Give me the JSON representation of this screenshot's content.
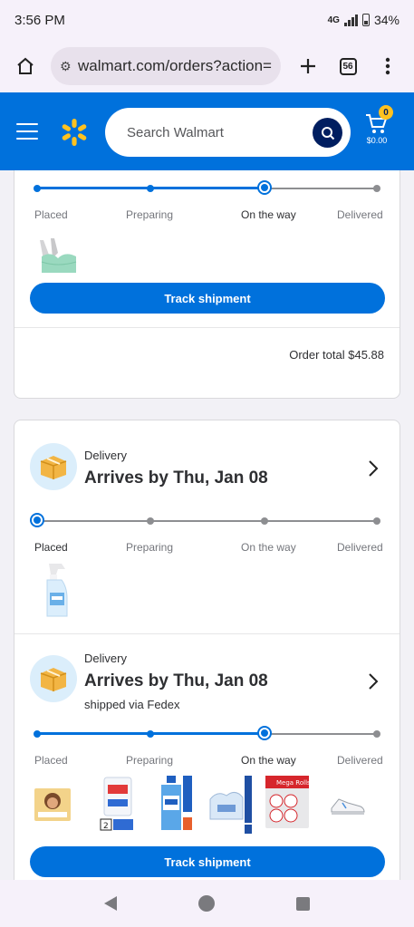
{
  "status_bar": {
    "time": "3:56 PM",
    "network": "4G",
    "battery": "34%"
  },
  "browser": {
    "url": "walmart.com/orders?action=",
    "tab_count": "56"
  },
  "header": {
    "search_placeholder": "Search Walmart",
    "cart_count": "0",
    "cart_total": "$0.00"
  },
  "steps": [
    "Placed",
    "Preparing",
    "On the way",
    "Delivered"
  ],
  "order1": {
    "progress_step": 2,
    "track_button": "Track shipment",
    "order_total": "Order total $45.88"
  },
  "order2": {
    "shipment1": {
      "type": "Delivery",
      "arrival": "Arrives by Thu, Jan 08",
      "progress_step": 0
    },
    "shipment2": {
      "type": "Delivery",
      "arrival": "Arrives by Thu, Jan 08",
      "carrier": "shipped via Fedex",
      "progress_step": 2,
      "track_button": "Track shipment"
    }
  },
  "colors": {
    "brand_blue": "#0071dc",
    "spark_yellow": "#ffc220",
    "navy": "#001e60"
  }
}
